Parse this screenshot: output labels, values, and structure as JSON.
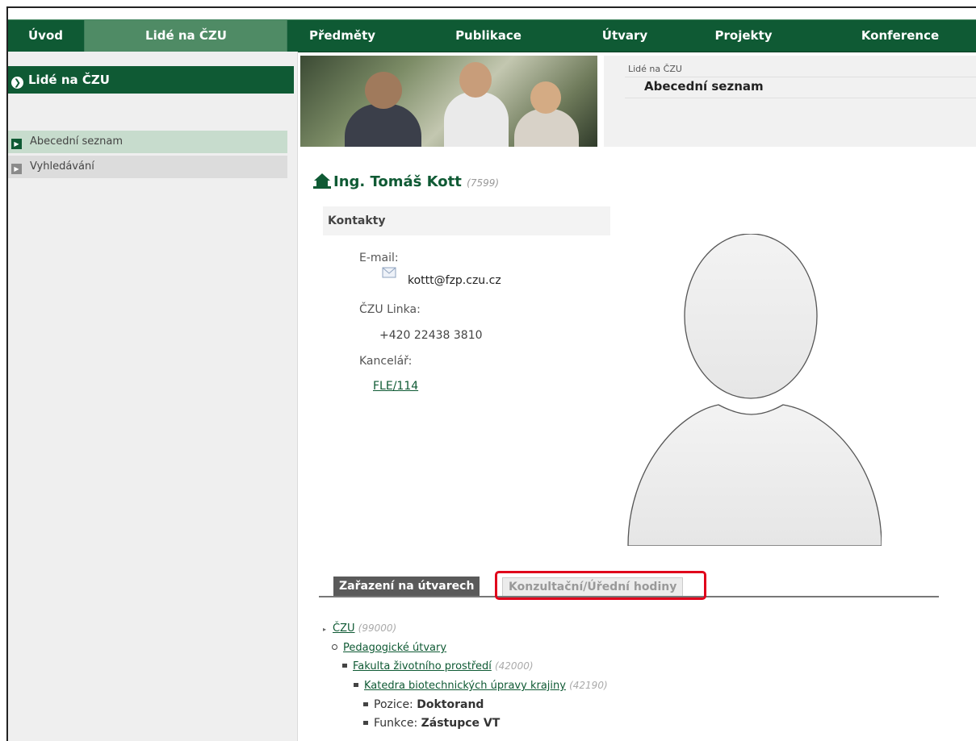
{
  "topnav": {
    "tabs": [
      {
        "label": "Úvod"
      },
      {
        "label": "Lidé na ČZU"
      },
      {
        "label": "Předměty"
      },
      {
        "label": "Publikace"
      },
      {
        "label": "Útvary"
      },
      {
        "label": "Projekty"
      },
      {
        "label": "Konference"
      }
    ],
    "active_index": 1,
    "color": "#0f5a34"
  },
  "sidebar": {
    "title": "Lidé na ČZU",
    "items": [
      {
        "label": "Abecední seznam",
        "active": true
      },
      {
        "label": "Vyhledávání",
        "active": false
      }
    ]
  },
  "header": {
    "breadcrumb": "Lidé na ČZU",
    "title": "Abecední seznam"
  },
  "person": {
    "name": "Ing. Tomáš Kott",
    "id": "(7599)"
  },
  "contacts": {
    "heading": "Kontakty",
    "email_label": "E-mail:",
    "email": "kottt@fzp.czu.cz",
    "phone_label": "ČZU Linka:",
    "phone": "+420 22438 3810",
    "office_label": "Kancelář:",
    "office": "FLE/114"
  },
  "tabs": {
    "tab1": "Zařazení na útvarech",
    "tab2": "Konzultační/Úřední hodiny",
    "highlight_color": "#e0001b"
  },
  "tree": [
    {
      "label": "ČZU",
      "code": "(99000)"
    },
    {
      "label": "Pedagogické útvary",
      "code": ""
    },
    {
      "label": "Fakulta životního prostředí",
      "code": "(42000)"
    },
    {
      "label": "Katedra biotechnických úpravy krajiny",
      "code": "(42190)"
    },
    {
      "label_prefix": "Pozice:",
      "value": "Doktorand"
    },
    {
      "label_prefix": "Funkce:",
      "value": "Zástupce VT"
    }
  ]
}
